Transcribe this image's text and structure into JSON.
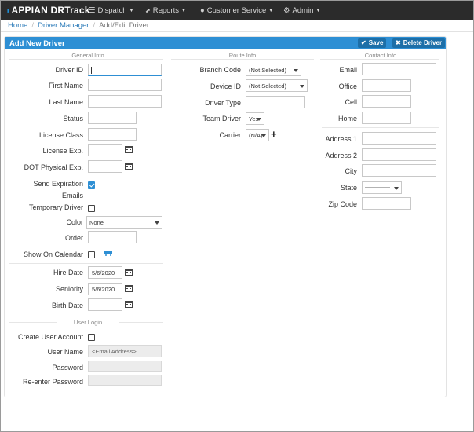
{
  "app": {
    "logo_mark": "◗",
    "logo_brand": "APPIAN",
    "logo_product": "DRTrack"
  },
  "nav": [
    {
      "label": "Dispatch",
      "icon": "list-icon",
      "glyph": "☰"
    },
    {
      "label": "Reports",
      "icon": "chart-icon",
      "glyph": "📈"
    },
    {
      "label": "Customer Service",
      "icon": "globe-icon",
      "glyph": "●"
    },
    {
      "label": "Admin",
      "icon": "gear-icon",
      "glyph": "⚙"
    }
  ],
  "breadcrumb": [
    "Home",
    "Driver Manager",
    "Add/Edit Driver"
  ],
  "panel": {
    "title": "Add New Driver",
    "save_label": "Save",
    "delete_label": "Delete Driver"
  },
  "sections": {
    "general": "General Info",
    "route": "Route Info",
    "contact": "Contact Info",
    "login": "User Login"
  },
  "general": {
    "driver_id": {
      "label": "Driver ID",
      "value": ""
    },
    "first_name": {
      "label": "First Name",
      "value": ""
    },
    "last_name": {
      "label": "Last Name",
      "value": ""
    },
    "status": {
      "label": "Status",
      "value": ""
    },
    "license_class": {
      "label": "License Class",
      "value": ""
    },
    "license_exp": {
      "label": "License Exp.",
      "value": ""
    },
    "dot_physical": {
      "label": "DOT Physical Exp.",
      "value": ""
    },
    "send_exp_emails": {
      "label_line1": "Send Expiration",
      "label_line2": "Emails",
      "checked": true
    },
    "temporary_driver": {
      "label": "Temporary Driver",
      "checked": false
    },
    "color": {
      "label": "Color",
      "value": "None"
    },
    "order": {
      "label": "Order",
      "value": ""
    },
    "show_on_calendar": {
      "label": "Show On Calendar",
      "checked": false,
      "icon": "truck-icon"
    },
    "hire_date": {
      "label": "Hire Date",
      "value": "5/6/2020"
    },
    "seniority": {
      "label": "Seniority",
      "value": "5/6/2020"
    },
    "birth_date": {
      "label": "Birth Date",
      "value": ""
    }
  },
  "login": {
    "create_account": {
      "label": "Create User Account",
      "checked": false
    },
    "user_name": {
      "label": "User Name",
      "value": "<Email Address>"
    },
    "password": {
      "label": "Password",
      "value": ""
    },
    "reenter_password": {
      "label": "Re-enter Password",
      "value": ""
    }
  },
  "route": {
    "branch_code": {
      "label": "Branch Code",
      "value": "(Not Selected)"
    },
    "device_id": {
      "label": "Device ID",
      "value": "(Not Selected)"
    },
    "driver_type": {
      "label": "Driver Type",
      "value": ""
    },
    "team_driver": {
      "label": "Team Driver",
      "value": "Yes"
    },
    "carrier": {
      "label": "Carrier",
      "value": "(N/A)"
    }
  },
  "contact": {
    "email": {
      "label": "Email",
      "value": ""
    },
    "office": {
      "label": "Office",
      "value": ""
    },
    "cell": {
      "label": "Cell",
      "value": ""
    },
    "home": {
      "label": "Home",
      "value": ""
    },
    "address1": {
      "label": "Address 1",
      "value": ""
    },
    "address2": {
      "label": "Address 2",
      "value": ""
    },
    "city": {
      "label": "City",
      "value": ""
    },
    "state": {
      "label": "State",
      "value": "----------------"
    },
    "zip": {
      "label": "Zip Code",
      "value": ""
    }
  },
  "colors": {
    "topbar": "#2b2b2b",
    "accent": "#2e8fd4",
    "header_button": "#1d6fa8"
  }
}
